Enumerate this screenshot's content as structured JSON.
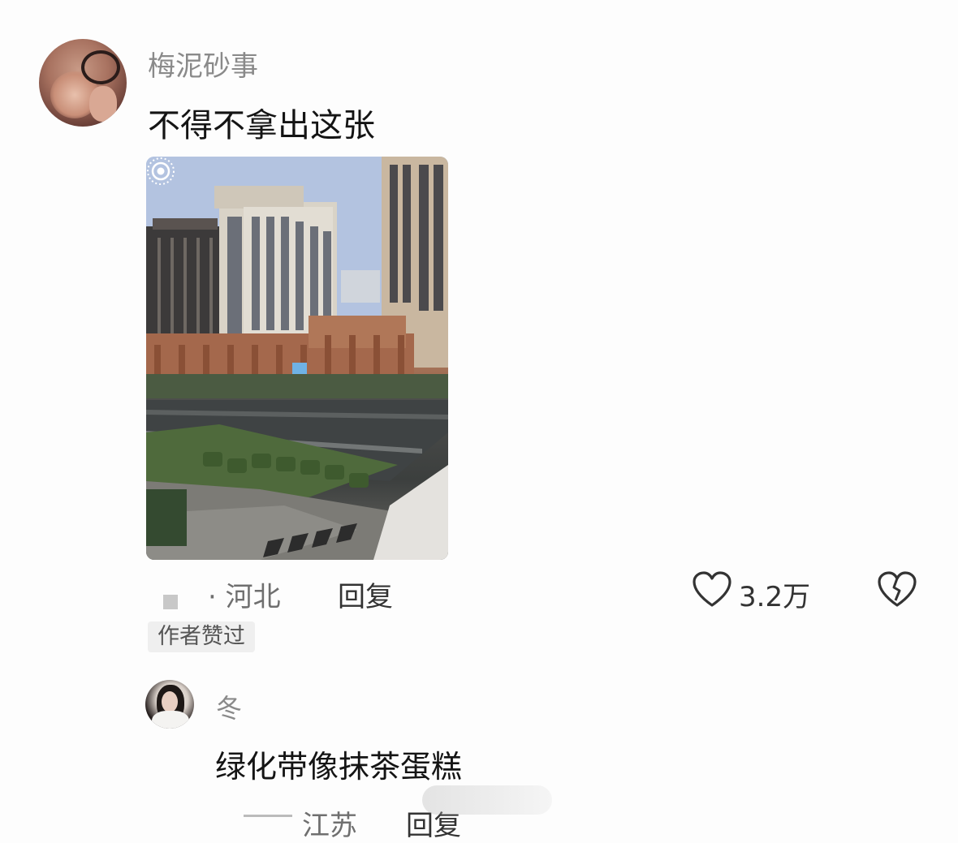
{
  "comment": {
    "username": "梅泥砂事",
    "text": "不得不拿出这张",
    "location": "· 河北",
    "reply_label": "回复",
    "author_liked_badge": "作者赞过",
    "like_count": "3.2万"
  },
  "reply": {
    "username": "冬",
    "text": "绿化带像抹茶蛋糕",
    "location": "江苏",
    "reply_label": "回复"
  },
  "icons": {
    "like": "heart-outline-icon",
    "dislike": "broken-heart-icon",
    "live_photo": "live-photo-icon"
  }
}
